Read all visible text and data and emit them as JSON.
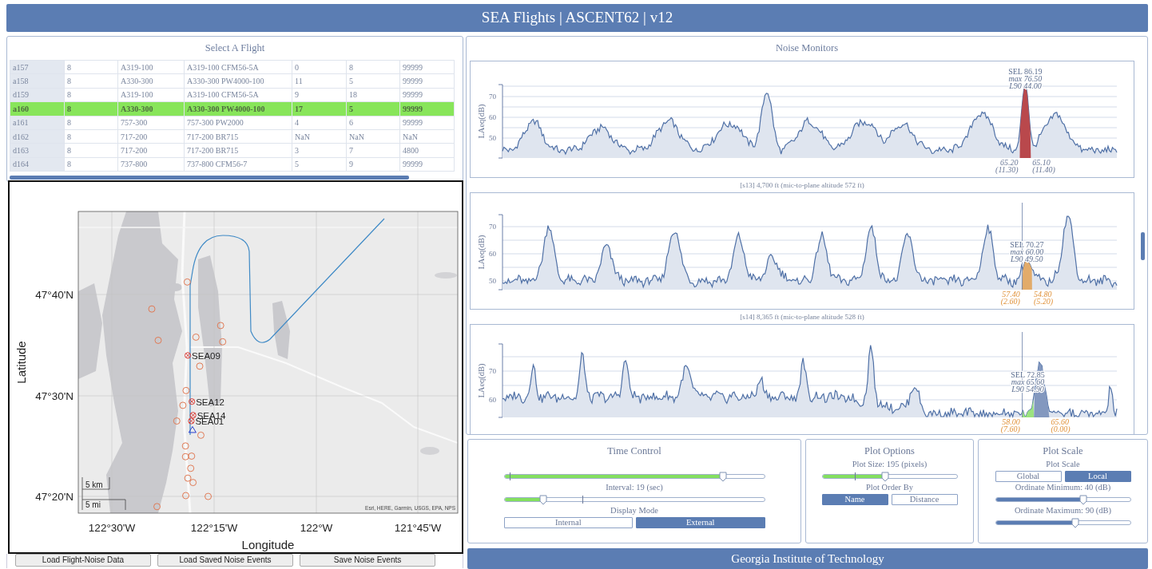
{
  "header": {
    "title": "SEA Flights | ASCENT62 | v12"
  },
  "flights": {
    "title": "Select A Flight",
    "rows": [
      {
        "cells": [
          "a157",
          "8",
          "A319-100",
          "A319-100 CFM56-5A",
          "0",
          "8",
          "99999"
        ],
        "selected": false
      },
      {
        "cells": [
          "a158",
          "8",
          "A330-300",
          "A330-300 PW4000-100",
          "11",
          "5",
          "99999"
        ],
        "selected": false
      },
      {
        "cells": [
          "d159",
          "8",
          "A319-100",
          "A319-100 CFM56-5A",
          "9",
          "18",
          "99999"
        ],
        "selected": false
      },
      {
        "cells": [
          "a160",
          "8",
          "A330-300",
          "A330-300 PW4000-100",
          "17",
          "5",
          "99999"
        ],
        "selected": true
      },
      {
        "cells": [
          "a161",
          "8",
          "757-300",
          "757-300 PW2000",
          "4",
          "6",
          "99999"
        ],
        "selected": false
      },
      {
        "cells": [
          "d162",
          "8",
          "717-200",
          "717-200 BR715",
          "NaN",
          "NaN",
          "NaN"
        ],
        "selected": false
      },
      {
        "cells": [
          "d163",
          "8",
          "717-200",
          "717-200 BR715",
          "3",
          "7",
          "4800"
        ],
        "selected": false
      },
      {
        "cells": [
          "d164",
          "8",
          "737-800",
          "737-800 CFM56-7",
          "5",
          "9",
          "99999"
        ],
        "selected": false
      }
    ]
  },
  "map": {
    "x_label": "Longitude",
    "y_label": "Latitude",
    "x_ticks": [
      "122°30'W",
      "122°15'W",
      "122°W",
      "121°45'W"
    ],
    "y_ticks": [
      "47°40'N",
      "47°30'N",
      "47°20'N"
    ],
    "stations": [
      {
        "label": "SEA09"
      },
      {
        "label": "SEA12"
      },
      {
        "label": "SEA14"
      },
      {
        "label": "SEA01"
      }
    ],
    "scale_bar": [
      "5 km",
      "5 mi"
    ],
    "attribution": "Esri, HERE, Garmin, USGS, EPA, NPS"
  },
  "buttons": [
    "Load Flight-Noise Data",
    "Load Saved Noise Events",
    "Save Noise Events"
  ],
  "noise_monitors": {
    "title": "Noise Monitors",
    "charts": [
      {
        "ylabel": "LAeq(dB)",
        "yticks": [
          "70",
          "60",
          "50"
        ],
        "event": {
          "bands": [
            {
              "color": "#b9484c"
            }
          ],
          "kind": "saved",
          "sel": "SEL 86.19",
          "max": "max 76.50",
          "l90": "L90 44.00",
          "start": "65.20",
          "start_sub": "(11.30)",
          "end": "65.10",
          "end_sub": "(11.40)"
        }
      },
      {
        "caption": "[s13] 4,700 ft (mic-to-plane altitude 572 ft)",
        "ylabel": "LAeq(dB)",
        "yticks": [
          "70",
          "60",
          "50"
        ],
        "event": {
          "bands": [
            {
              "color": "#e2ab6a"
            }
          ],
          "kind": "detected",
          "sel": "SEL 70.27",
          "max": "max 60.00",
          "l90": "L90 49.50",
          "start": "57.40",
          "start_sub": "(2.60)",
          "end": "54.80",
          "end_sub": "(5.20)"
        }
      },
      {
        "caption": "[s14] 8,365 ft (mic-to-plane altitude 528 ft)",
        "ylabel": "LAeq(dB)",
        "yticks": [
          "70",
          "60"
        ],
        "event": {
          "bands": [
            {
              "color": "#9be37f"
            },
            {
              "color": "#8398bf"
            }
          ],
          "kind": "detected",
          "sel": "SEL 72.85",
          "max": "max 65.60",
          "l90": "L90 54.90",
          "start": "58.00",
          "start_sub": "(7.60)",
          "end": "65.60",
          "end_sub": "(0.00)"
        }
      }
    ]
  },
  "controls": [
    {
      "title": "Time Control",
      "items": [
        {
          "kind": "slider",
          "level": 0.84
        },
        {
          "kind": "label",
          "text": "Interval: 19 (sec)"
        },
        {
          "kind": "slider",
          "level": 0.15
        },
        {
          "kind": "label",
          "text": "Display Mode"
        },
        {
          "kind": "segmented",
          "options": [
            {
              "label": "Internal",
              "selected": false
            },
            {
              "label": "External",
              "selected": true
            }
          ]
        }
      ]
    },
    {
      "title": "Plot Options",
      "items": [
        {
          "kind": "label",
          "text": "Plot Size: 195 (pixels)"
        },
        {
          "kind": "slider",
          "level": 0.47
        },
        {
          "kind": "label",
          "text": "Plot Order By"
        },
        {
          "kind": "segmented",
          "options": [
            {
              "label": "Name",
              "selected": true
            },
            {
              "label": "Distance",
              "selected": false
            }
          ]
        }
      ]
    },
    {
      "title": "Plot Scale",
      "items": [
        {
          "kind": "label",
          "text": "Plot Scale"
        },
        {
          "kind": "segmented",
          "options": [
            {
              "label": "Global",
              "selected": false
            },
            {
              "label": "Local",
              "selected": true
            }
          ]
        },
        {
          "kind": "label",
          "text": "Ordinate Minimum: 40 (dB)"
        },
        {
          "kind": "scale-slider",
          "level": 0.65
        },
        {
          "kind": "label",
          "text": "Ordinate Maximum: 90 (dB)"
        },
        {
          "kind": "scale-slider",
          "level": 0.59
        }
      ]
    }
  ],
  "footer": {
    "text": "Georgia Institute of Technology"
  }
}
